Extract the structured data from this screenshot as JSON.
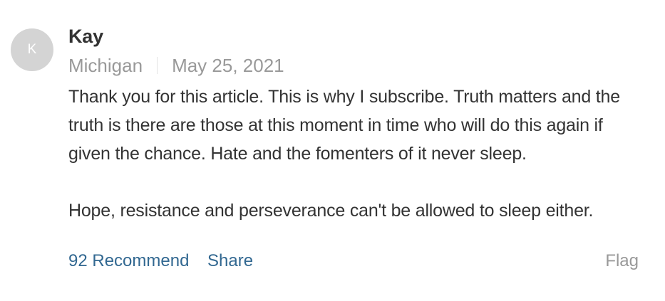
{
  "comment": {
    "avatar_initial": "K",
    "author": "Kay",
    "location": "Michigan",
    "date": "May 25, 2021",
    "paragraphs": [
      "Thank you for this article. This is why I subscribe. Truth matters and the truth is there are those at this moment in time who will do this again if given the chance. Hate and the fomenters of it never sleep.",
      "Hope, resistance and perseverance can't be allowed to sleep either."
    ],
    "recommend_label": "92 Recommend",
    "share_label": "Share",
    "flag_label": "Flag"
  },
  "colors": {
    "link": "#326891",
    "muted": "#999999",
    "avatar_bg": "#d4d4d4",
    "text": "#333333"
  }
}
